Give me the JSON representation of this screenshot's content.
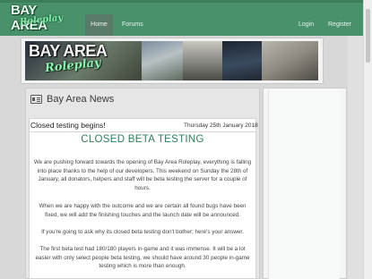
{
  "header": {
    "logo_line1": "BAY AREA",
    "logo_line2": "Roleplay",
    "nav": {
      "home": "Home",
      "forums": "Forums",
      "login": "Login",
      "register": "Register"
    }
  },
  "banner": {
    "logo_line1": "BAY AREA",
    "logo_line2": "Roleplay"
  },
  "news": {
    "title": "Bay Area News",
    "post": {
      "title": "Closed testing begins!",
      "date": "Thursday 25th January 2018",
      "heading": "CLOSED BETA TESTING",
      "paragraphs": [
        "We are pushing forward towards the opening of Bay Area Roleplay, everything is falling into place thanks to the help of our developers. This weekend on Sunday the 28th of January, all donators, helpers and staff will be beta testing the server for a couple of hours.",
        "When we are happy with the outcome and we are certain all found bugs have been fixed, we will add the finishing touches and the launch date will be announced.",
        "If you're going to ask why its closed beta testing don't bother; here's your answer.",
        "The first beta test had 180/180 players in-game and it was immense. It will be a lot easier with only select people beta testing, we should have around 30 people in-game testing which is more than enough."
      ]
    }
  },
  "colors": {
    "header_green": "#48916b",
    "accent_green": "#2f7f5c"
  }
}
